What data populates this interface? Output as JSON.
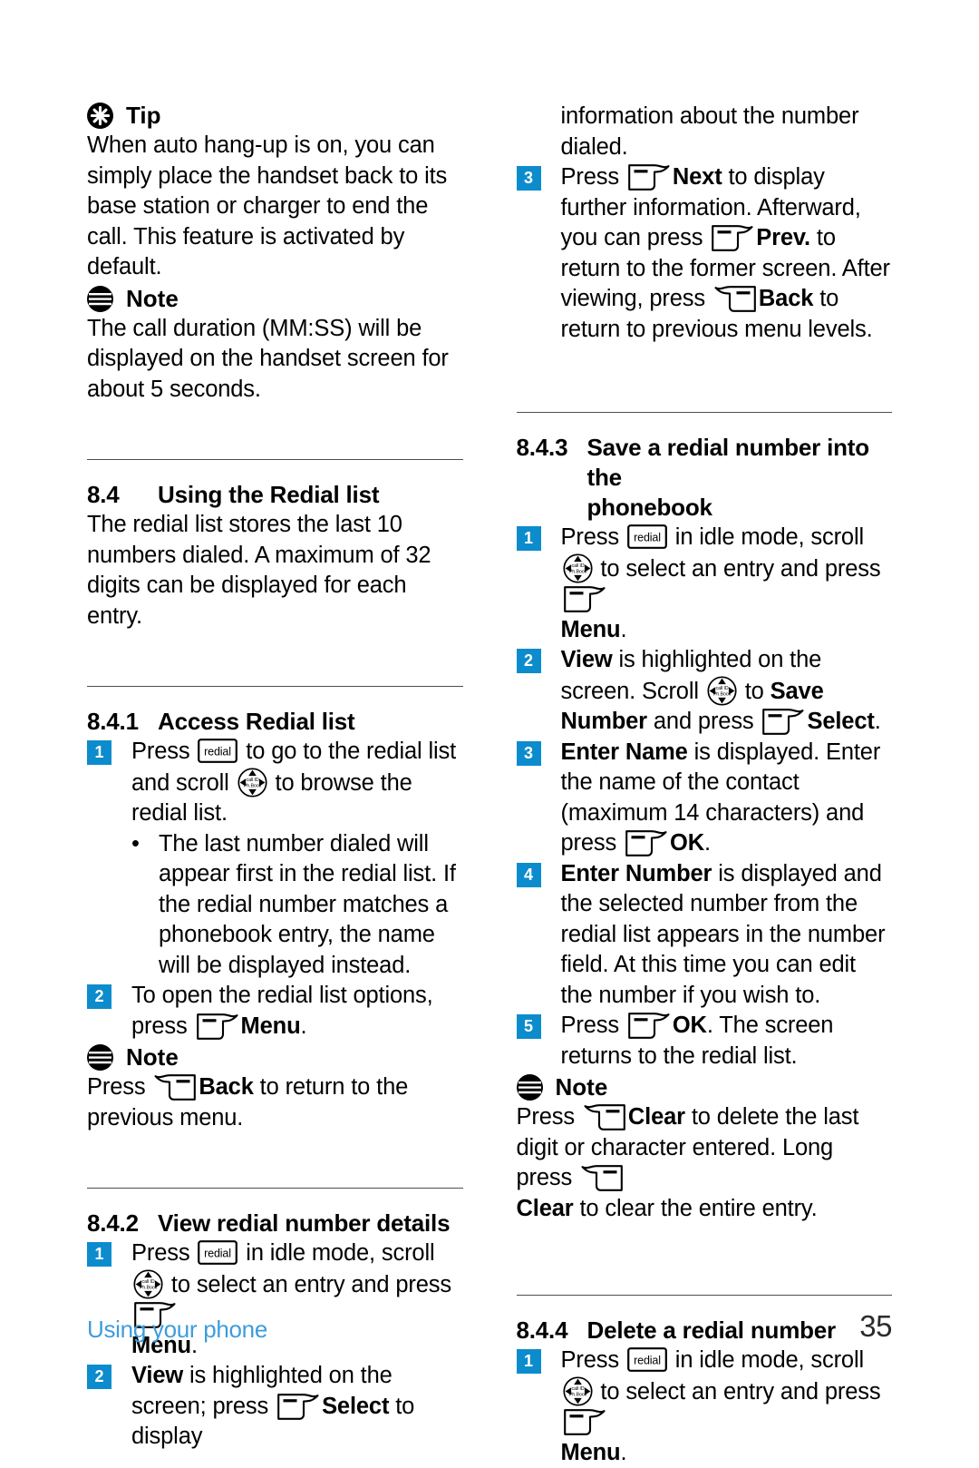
{
  "document": {
    "footer_chapter": "Using your phone",
    "footer_page": "35",
    "accent_blue": "#0d8ccd",
    "footer_blue": "#3e9ddb"
  },
  "icons": {
    "tip": "tip-asterisk-icon",
    "note": "note-lines-icon",
    "redial": "redial-key-icon",
    "softkey_left": "left-softkey-icon",
    "softkey_right": "right-softkey-icon",
    "nav": "navigation-scroll-key-icon",
    "redial_label": "redial",
    "nav_label_top": "call ID",
    "nav_label_bottom": "Ph.Book"
  },
  "left_column": {
    "tip": {
      "title": "Tip",
      "body": "When auto hang-up is on, you can simply place the handset back to its base station or charger to end the call. This feature is activated by default."
    },
    "note1": {
      "title": "Note",
      "body": "The call duration (MM:SS) will be displayed on the handset screen for about 5 seconds."
    },
    "section_84": {
      "number": "8.4",
      "title": "Using the Redial list",
      "body": "The redial list stores the last 10 numbers dialed. A maximum of 32 digits can be displayed for each entry."
    },
    "section_841": {
      "number": "8.4.1",
      "title": "Access Redial list",
      "step1": {
        "n": "1",
        "t1": "Press ",
        "t2": " to go to the redial list and scroll ",
        "t3": " to browse the redial list."
      },
      "bullet1": "The last number dialed will appear first in the redial list. If the redial number matches a phonebook entry, the name will be displayed instead.",
      "step2": {
        "n": "2",
        "t1": "To open the redial list options, press ",
        "t2": "Menu",
        "t3": "."
      }
    },
    "note2": {
      "title": "Note",
      "t1": "Press ",
      "t2": "Back",
      "t3": " to return to the previous menu."
    },
    "section_842": {
      "number": "8.4.2",
      "title": "View redial number details",
      "step1": {
        "n": "1",
        "t1": "Press ",
        "t2": " in idle mode, scroll ",
        "t3": " to select an entry and press ",
        "t4": "Menu",
        "t5": "."
      },
      "step2": {
        "n": "2",
        "t1": "View",
        "t2": " is highlighted on the screen; press ",
        "t3": "Select",
        "t4": " to display"
      }
    }
  },
  "right_column": {
    "continuation": "information about the number dialed.",
    "step3": {
      "n": "3",
      "t1": "Press ",
      "t2": "Next",
      "t3": " to display further information. Afterward, you can press ",
      "t4": "Prev.",
      "t5": " to return to the former screen. After viewing, press ",
      "t6": "Back",
      "t7": " to return to previous menu levels."
    },
    "section_843": {
      "number": "8.4.3",
      "title_line1": "Save a redial number into the",
      "title_line2": "phonebook",
      "step1": {
        "n": "1",
        "t1": "Press ",
        "t2": " in idle mode, scroll ",
        "t3": " to select an entry and press ",
        "t4": "Menu",
        "t5": "."
      },
      "step2": {
        "n": "2",
        "t1": "View",
        "t2": " is highlighted on the screen. Scroll ",
        "t3": " to ",
        "t4": "Save Number",
        "t5": " and press ",
        "t6": "Select",
        "t7": "."
      },
      "step3": {
        "n": "3",
        "t1": "Enter Name",
        "t2": " is displayed. Enter the name of the contact (maximum 14 characters) and press ",
        "t3": "OK",
        "t4": "."
      },
      "step4": {
        "n": "4",
        "t1": "Enter Number",
        "t2": " is displayed and the selected number from the redial list appears in the number field. At this time you can edit the number if you wish to."
      },
      "step5": {
        "n": "5",
        "t1": "Press ",
        "t2": "OK",
        "t3": ". The screen returns to the redial list."
      }
    },
    "note3": {
      "title": "Note",
      "t1": "Press ",
      "t2": "Clear",
      "t3": " to delete the last digit or character entered. Long press ",
      "t4": "Clear",
      "t5": " to clear the entire entry."
    },
    "section_844": {
      "number": "8.4.4",
      "title": "Delete a redial number",
      "step1": {
        "n": "1",
        "t1": "Press ",
        "t2": " in idle mode, scroll ",
        "t3": " to select an entry and press ",
        "t4": "Menu",
        "t5": "."
      }
    }
  }
}
